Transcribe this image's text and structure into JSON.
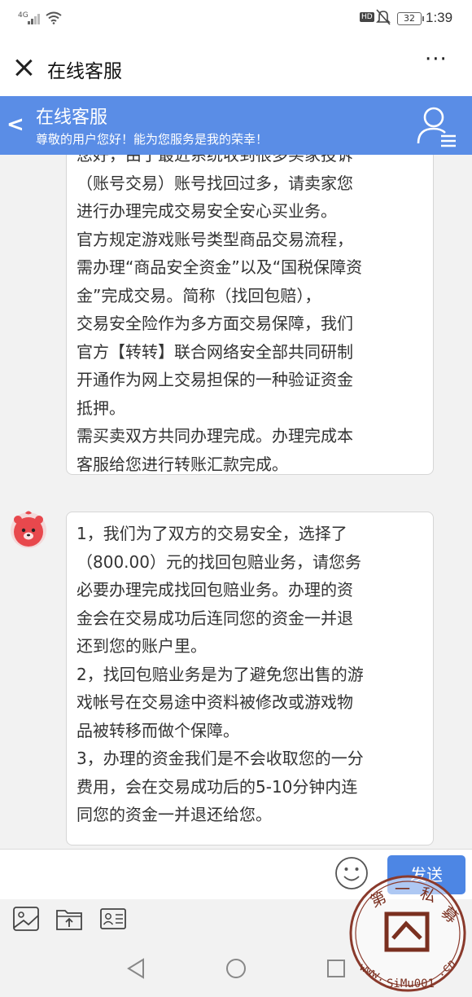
{
  "status_bar": {
    "network": "4G",
    "battery": "32",
    "time": "1:39"
  },
  "app_bar": {
    "title": "在线客服",
    "more": "···"
  },
  "service_header": {
    "title": "在线客服",
    "subtitle": "尊敬的用户您好！能为您服务是我的荣幸！"
  },
  "messages": [
    {
      "lines": [
        "您好，由于最近系统收到很多买家投诉",
        "（账号交易）账号找回过多，请卖家您",
        "进行办理完成交易安全安心买业务。",
        "官方规定游戏账号类型商品交易流程，",
        "需办理“商品安全资金”以及“国税保障资",
        "金”完成交易。简称（找回包赔），",
        "交易安全险作为多方面交易保障，我们",
        "官方【转转】联合网络安全部共同研制",
        "开通作为网上交易担保的一种验证资金",
        "抵押。",
        "需买卖双方共同办理完成。办理完成本",
        "客服给您进行转账汇款完成。"
      ]
    },
    {
      "lines": [
        "1，我们为了双方的交易安全，选择了",
        "（800.00）元的找回包赔业务，请您务",
        "必要办理完成找回包赔业务。办理的资",
        "金会在交易成功后连同您的资金一并退",
        "还到您的账户里。",
        "2，找回包赔业务是为了避免您出售的游",
        "戏帐号在交易途中资料被修改或游戏物",
        "品被转移而做个保障。",
        "3，办理的资金我们是不会收取您的一分",
        "费用，会在交易成功后的5-10分钟内连",
        "同您的资金一并退还给您。"
      ]
    }
  ],
  "input_bar": {
    "placeholder": "",
    "send_label": "发送"
  },
  "tools": [
    "image-icon",
    "folder-upload-icon",
    "id-card-icon"
  ],
  "watermark": {
    "text": "第一私募 www.SiMu001.cn"
  },
  "colors": {
    "header_blue": "#5a8de6",
    "send_blue": "#4d86e4",
    "avatar_red": "#e8484d"
  }
}
